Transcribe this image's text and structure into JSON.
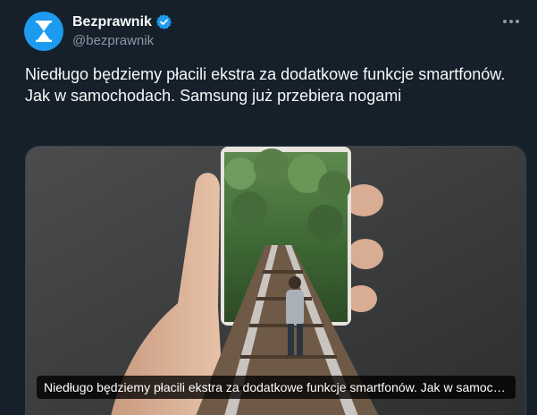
{
  "author": {
    "display_name": "Bezprawnik",
    "handle": "@bezprawnik",
    "verified": true,
    "avatar_icon": "hourglass-icon",
    "brand_color": "#1d9bf0"
  },
  "tweet": {
    "text": "Niedługo będziemy płacili ekstra za dodatkowe funkcje smartfonów. Jak w samochodach. Samsung już przebiera nogami"
  },
  "media": {
    "caption": "Niedługo będziemy płacili ekstra za dodatkowe funkcje smartfonów. Jak w samochodach. Samsung już przebiera nogami"
  },
  "icons": {
    "more": "more-icon",
    "verified": "verified-badge-icon"
  }
}
